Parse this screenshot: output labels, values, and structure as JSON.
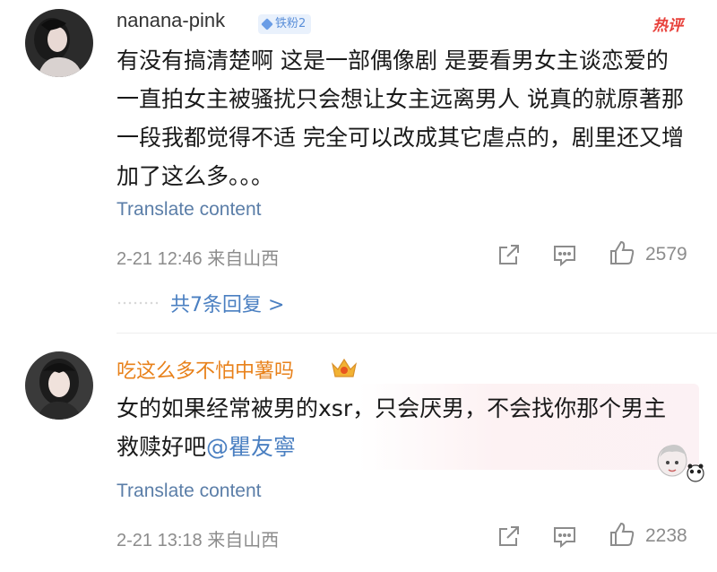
{
  "comments": [
    {
      "username": "nanana-pink",
      "badge": "铁粉2",
      "hot_tag": "热评",
      "body": "有没有搞清楚啊 这是一部偶像剧 是要看男女主谈恋爱的 一直拍女主被骚扰只会想让女主远离男人 说真的就原著那一段我都觉得不适 完全可以改成其它虐点的，剧里还又增加了这么多。。。",
      "translate": "Translate content",
      "meta": "2-21 12:46  来自山西",
      "like_count": "2579",
      "replies": "共7条回复 >"
    },
    {
      "username": "吃这么多不怕中薯吗",
      "body_prefix": "女的如果经常被男的xsr，只会厌男，不会找你那个男主救赎好吧",
      "mention": "@瞿友寧",
      "translate": "Translate content",
      "meta": "2-21 13:18  来自山西",
      "like_count": "2238"
    }
  ],
  "icons": [
    "share-icon",
    "comment-icon",
    "like-icon",
    "crown-icon",
    "sticker-icon"
  ],
  "colors": {
    "link": "#4a7fc1",
    "username_vip": "#e8811a",
    "meta": "#8c8c8c",
    "hot": "#e8403a"
  }
}
